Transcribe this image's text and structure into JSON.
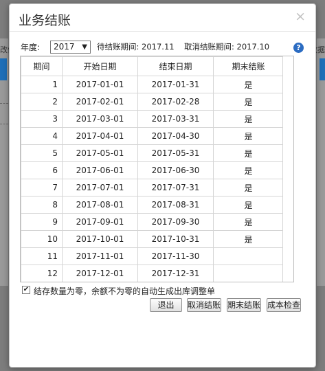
{
  "background": {
    "left_label": "改修",
    "right_label": "数据"
  },
  "dialog": {
    "title": "业务结账",
    "close": "×",
    "year_label": "年度:",
    "year_value": "2017",
    "pending_label": "待结账期间: 2017.11",
    "cancel_label": "取消结账期间: 2017.10",
    "help": "?"
  },
  "table": {
    "columns": [
      "期间",
      "开始日期",
      "结束日期",
      "期末结账"
    ],
    "rows": [
      {
        "period": "1",
        "start": "2017-01-01",
        "end": "2017-01-31",
        "closed": "是"
      },
      {
        "period": "2",
        "start": "2017-02-01",
        "end": "2017-02-28",
        "closed": "是"
      },
      {
        "period": "3",
        "start": "2017-03-01",
        "end": "2017-03-31",
        "closed": "是"
      },
      {
        "period": "4",
        "start": "2017-04-01",
        "end": "2017-04-30",
        "closed": "是"
      },
      {
        "period": "5",
        "start": "2017-05-01",
        "end": "2017-05-31",
        "closed": "是"
      },
      {
        "period": "6",
        "start": "2017-06-01",
        "end": "2017-06-30",
        "closed": "是"
      },
      {
        "period": "7",
        "start": "2017-07-01",
        "end": "2017-07-31",
        "closed": "是"
      },
      {
        "period": "8",
        "start": "2017-08-01",
        "end": "2017-08-31",
        "closed": "是"
      },
      {
        "period": "9",
        "start": "2017-09-01",
        "end": "2017-09-30",
        "closed": "是"
      },
      {
        "period": "10",
        "start": "2017-10-01",
        "end": "2017-10-31",
        "closed": "是"
      },
      {
        "period": "11",
        "start": "2017-11-01",
        "end": "2017-11-30",
        "closed": ""
      },
      {
        "period": "12",
        "start": "2017-12-01",
        "end": "2017-12-31",
        "closed": ""
      }
    ]
  },
  "checkbox": {
    "label": "结存数量为零，余额不为零的自动生成出库调整单",
    "checked": true
  },
  "buttons": {
    "exit": "退出",
    "cancel_close": "取消结账",
    "period_close": "期末结账",
    "cost_check": "成本检查"
  },
  "colors": {
    "accent": "#2b6cc2",
    "overlay": "#7d7d7d"
  }
}
